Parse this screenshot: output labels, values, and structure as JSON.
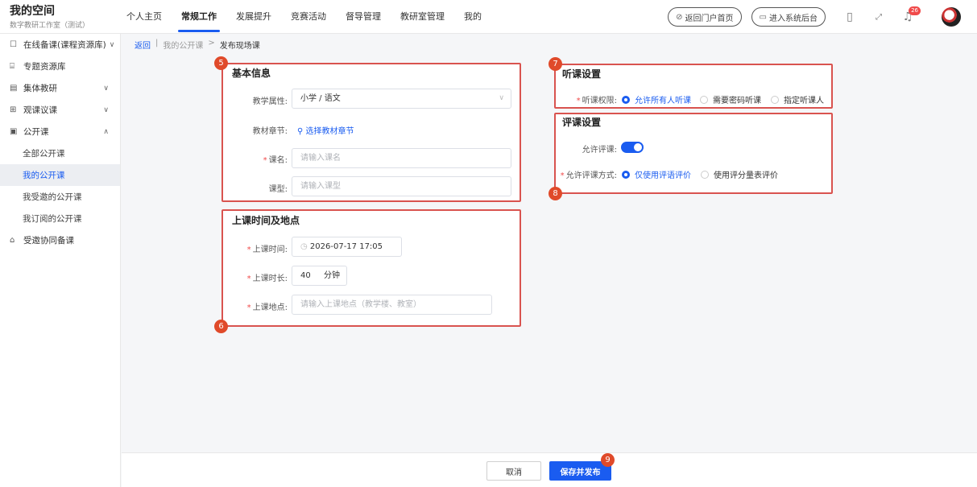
{
  "header": {
    "title": "我的空间",
    "subtitle": "数字教研工作室（测试）",
    "nav": [
      "个人主页",
      "常规工作",
      "发展提升",
      "竞赛活动",
      "督导管理",
      "教研室管理",
      "我的"
    ],
    "portal_btn": "返回门户首页",
    "admin_btn": "进入系统后台",
    "bell_count": "26"
  },
  "sidebar": {
    "items": [
      {
        "label": "在线备课(课程资源库)",
        "chev": "∨"
      },
      {
        "label": "专题资源库",
        "chev": ""
      },
      {
        "label": "集体教研",
        "chev": "∨"
      },
      {
        "label": "观课议课",
        "chev": "∨"
      },
      {
        "label": "公开课",
        "chev": "∧"
      }
    ],
    "subs": [
      "全部公开课",
      "我的公开课",
      "我受邀的公开课",
      "我订阅的公开课"
    ],
    "last": "受邀协同备课"
  },
  "breadcrumb": {
    "back": "返回",
    "sep": "|",
    "parent": "我的公开课",
    "arrow": ">",
    "current": "发布现场课"
  },
  "basic": {
    "title": "基本信息",
    "subject_label": "教学属性:",
    "subject_value": "小学 / 语文",
    "chapter_label": "教材章节:",
    "chapter_link": "选择教材章节",
    "name_label": "课名:",
    "name_placeholder": "请输入课名",
    "type_label": "课型:",
    "type_placeholder": "请输入课型"
  },
  "schedule": {
    "title": "上课时间及地点",
    "time_label": "上课时间:",
    "time_value": "2026-07-17 17:05",
    "duration_label": "上课时长:",
    "duration_value": "40",
    "duration_unit": "分钟",
    "place_label": "上课地点:",
    "place_placeholder": "请输入上课地点（教学楼、教室）"
  },
  "listen": {
    "title": "听课设置",
    "perm_label": "听课权限:",
    "options": [
      "允许所有人听课",
      "需要密码听课",
      "指定听课人"
    ]
  },
  "review": {
    "title": "评课设置",
    "allow_label": "允许评课:",
    "mode_label": "允许评课方式:",
    "options": [
      "仅使用评语评价",
      "使用评分量表评价"
    ]
  },
  "markers": [
    "5",
    "6",
    "7",
    "8",
    "9"
  ],
  "footer": {
    "cancel": "取消",
    "save": "保存并发布"
  },
  "colors": {
    "accent": "#1a5cf0",
    "highlight_box": "#d9534f",
    "badge": "#e04a2a"
  }
}
